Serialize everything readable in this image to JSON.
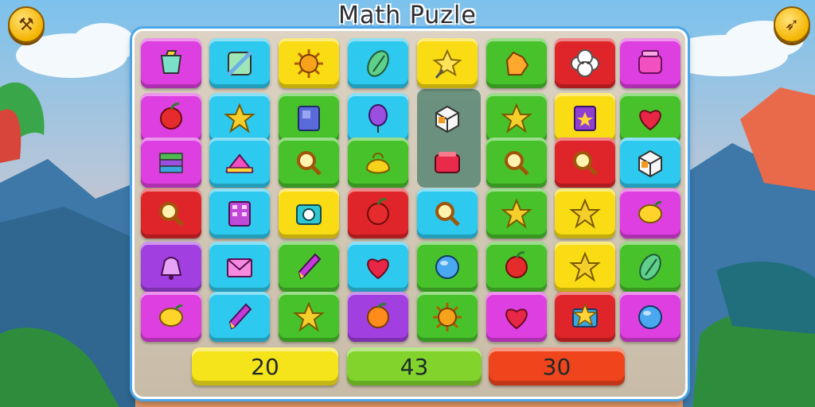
{
  "title": "Math Puzle",
  "colors": {
    "magenta": "#de3fe0",
    "cyan": "#2ec9ee",
    "yellow": "#f9dc14",
    "green": "#47c22b",
    "red": "#e0252a",
    "purple": "#a23fe0",
    "slate": "#5f8a78"
  },
  "buttons": {
    "left_icon": "tools-icon",
    "right_icon": "bow-icon"
  },
  "grid": {
    "rows": [
      [
        {
          "color": "magenta",
          "icon": "cup-icon"
        },
        {
          "color": "cyan",
          "icon": "square-icon"
        },
        {
          "color": "yellow",
          "icon": "sun-icon"
        },
        {
          "color": "cyan",
          "icon": "leaf-icon"
        },
        {
          "color": "yellow",
          "icon": "star-wand-icon"
        },
        {
          "color": "green",
          "icon": "hand-icon"
        },
        {
          "color": "red",
          "icon": "cloud-icon"
        },
        {
          "color": "magenta",
          "icon": "box-icon"
        }
      ],
      [
        {
          "color": "magenta",
          "icon": "apple-icon"
        },
        {
          "color": "cyan",
          "icon": "star-icon"
        },
        {
          "color": "green",
          "icon": "cabinet-icon"
        },
        {
          "color": "cyan",
          "icon": "balloon-icon"
        },
        {
          "color": "slate",
          "icon": "cube-icon"
        },
        {
          "color": "green",
          "icon": "star-icon"
        },
        {
          "color": "yellow",
          "icon": "book-icon"
        },
        {
          "color": "green",
          "icon": "heart-icon"
        }
      ],
      [
        {
          "color": "magenta",
          "icon": "stack-icon"
        },
        {
          "color": "cyan",
          "icon": "triangle-icon"
        },
        {
          "color": "green",
          "icon": "magnifier-icon"
        },
        {
          "color": "green",
          "icon": "bag-icon"
        },
        {
          "color": "slate",
          "icon": "block-icon"
        },
        {
          "color": "green",
          "icon": "magnifier-icon"
        },
        {
          "color": "red",
          "icon": "magnifier-icon"
        },
        {
          "color": "cyan",
          "icon": "cube-icon"
        }
      ],
      [
        {
          "color": "red",
          "icon": "magnifier-icon"
        },
        {
          "color": "cyan",
          "icon": "grid-icon"
        },
        {
          "color": "yellow",
          "icon": "camera-icon"
        },
        {
          "color": "red",
          "icon": "apple-icon"
        },
        {
          "color": "cyan",
          "icon": "magnifier-icon"
        },
        {
          "color": "green",
          "icon": "star-icon"
        },
        {
          "color": "yellow",
          "icon": "star-icon"
        },
        {
          "color": "magenta",
          "icon": "lemon-icon"
        }
      ],
      [
        {
          "color": "purple",
          "icon": "bell-icon"
        },
        {
          "color": "cyan",
          "icon": "envelope-icon"
        },
        {
          "color": "green",
          "icon": "pencil-icon"
        },
        {
          "color": "cyan",
          "icon": "heart-icon"
        },
        {
          "color": "green",
          "icon": "ball-icon"
        },
        {
          "color": "green",
          "icon": "apple-icon"
        },
        {
          "color": "yellow",
          "icon": "star-icon"
        },
        {
          "color": "green",
          "icon": "leaf-icon"
        }
      ],
      [
        {
          "color": "magenta",
          "icon": "lemon-icon"
        },
        {
          "color": "cyan",
          "icon": "pencil-icon"
        },
        {
          "color": "green",
          "icon": "star-icon"
        },
        {
          "color": "purple",
          "icon": "orange-icon"
        },
        {
          "color": "green",
          "icon": "sun-icon"
        },
        {
          "color": "magenta",
          "icon": "heart-icon"
        },
        {
          "color": "red",
          "icon": "star-box-icon"
        },
        {
          "color": "magenta",
          "icon": "ball-icon"
        }
      ]
    ]
  },
  "answers": [
    {
      "label": "20",
      "color": "#f5e41a"
    },
    {
      "label": "43",
      "color": "#82d42c"
    },
    {
      "label": "30",
      "color": "#f0441d"
    }
  ]
}
